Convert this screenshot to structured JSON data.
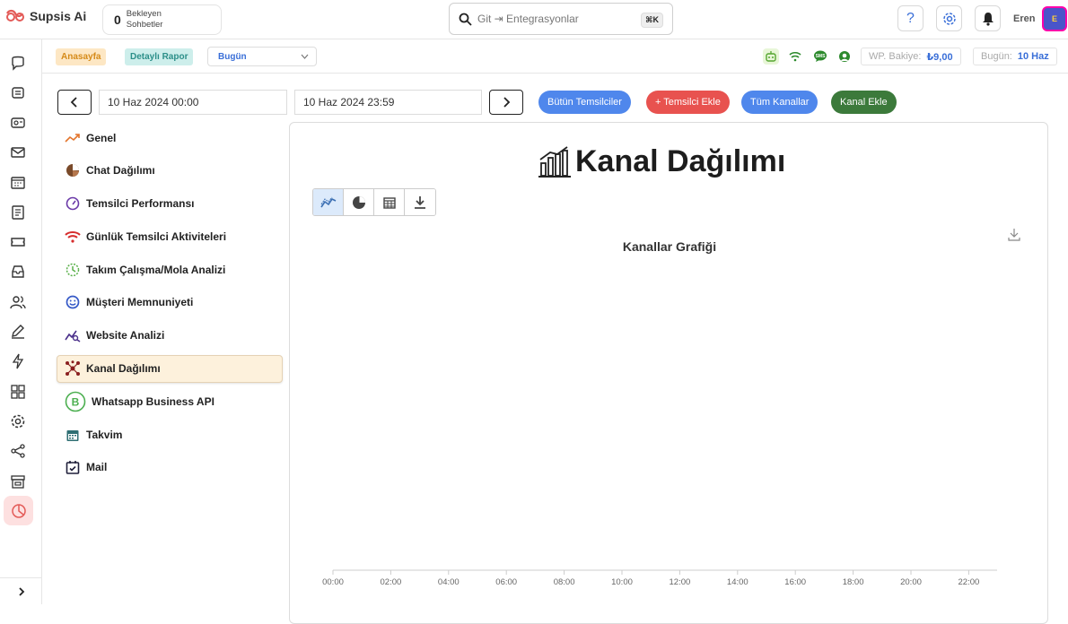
{
  "app": {
    "name": "Supsis Ai"
  },
  "header": {
    "pending_count": "0",
    "pending_label_1": "Bekleyen",
    "pending_label_2": "Sohbetler",
    "search_placeholder": "Git ⇥ Entegrasyonlar",
    "search_shortcut": "⌘K",
    "user_name": "Eren",
    "avatar_text": "E"
  },
  "subbar": {
    "home": "Anasayfa",
    "detailed_report": "Detaylı Rapor",
    "period": "Bugün",
    "wp_balance_label": "WP. Bakiye:",
    "wp_balance_value": "₺9,00",
    "today_label": "Bugün:",
    "today_value": "10 Haz"
  },
  "filters": {
    "start_date": "10 Haz 2024 00:00",
    "end_date": "10 Haz 2024 23:59",
    "all_agents": "Bütün Temsilciler",
    "add_agent": "+ Temsilci Ekle",
    "all_channels": "Tüm Kanallar",
    "add_channel": "Kanal Ekle"
  },
  "menu": {
    "items": [
      {
        "label": "Genel"
      },
      {
        "label": "Chat Dağılımı"
      },
      {
        "label": "Temsilci Performansı"
      },
      {
        "label": "Günlük Temsilci Aktiviteleri"
      },
      {
        "label": "Takım Çalışma/Mola Analizi"
      },
      {
        "label": "Müşteri Memnuniyeti"
      },
      {
        "label": "Website Analizi"
      },
      {
        "label": "Kanal Dağılımı"
      },
      {
        "label": "Whatsapp Business API"
      },
      {
        "label": "Takvim"
      },
      {
        "label": "Mail"
      }
    ],
    "active_index": 7
  },
  "panel": {
    "title": "Kanal Dağılımı",
    "chart_title": "Kanallar Grafiği"
  },
  "chart_data": {
    "type": "line",
    "title": "Kanallar Grafiği",
    "x": [
      "00:00",
      "02:00",
      "04:00",
      "06:00",
      "08:00",
      "10:00",
      "12:00",
      "14:00",
      "16:00",
      "18:00",
      "20:00",
      "22:00"
    ],
    "series": []
  },
  "colors": {
    "accent_blue": "#4f87ec",
    "accent_red": "#e8524f",
    "accent_green": "#3c7a3b",
    "active_menu_bg": "#fdf1dc"
  }
}
